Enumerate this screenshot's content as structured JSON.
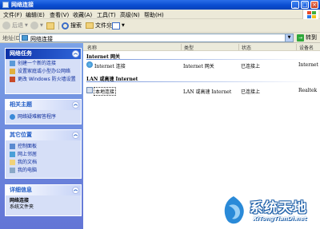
{
  "window": {
    "title": "网络连接"
  },
  "menu": [
    "文件(F)",
    "编辑(E)",
    "查看(V)",
    "收藏(A)",
    "工具(T)",
    "高级(N)",
    "帮助(H)"
  ],
  "toolbar": {
    "back": "后退",
    "search": "搜索",
    "folders": "文件夹"
  },
  "address": {
    "label": "地址(D)",
    "value": "网络连接",
    "go": "转到"
  },
  "taskpane": {
    "network_tasks": {
      "title": "网络任务",
      "items": [
        "创建一个新的连接",
        "设置家庭或小型办公网络",
        "更改 Windows 防火墙设置"
      ]
    },
    "see_also": {
      "title": "相关主题",
      "items": [
        "网络疑难解答程序"
      ]
    },
    "other_places": {
      "title": "其它位置",
      "items": [
        "控制面板",
        "网上邻居",
        "我的文档",
        "我的电脑"
      ]
    },
    "details": {
      "title": "详细信息",
      "name": "网络连接",
      "type": "系统文件夹"
    }
  },
  "columns": {
    "name": "名称",
    "type": "类型",
    "status": "状态",
    "device": "设备名"
  },
  "groups": [
    {
      "title": "Internet 网关",
      "rows": [
        {
          "name": "Internet 连接",
          "type": "Internet 网关",
          "status": "已连接上",
          "device": "Internet"
        }
      ]
    },
    {
      "title": "LAN 或高速 Internet",
      "rows": [
        {
          "name": "本地连接",
          "type": "LAN 或高速 Internet",
          "status": "已连接上",
          "device": "Realtek"
        }
      ]
    }
  ],
  "watermark": {
    "cn": "系统天地",
    "en": "XiTongTianDi.net"
  },
  "colors": {
    "titlebar": "#0a4dd1",
    "taskpane": "#7ba2e7",
    "link": "#0c2c9c"
  }
}
